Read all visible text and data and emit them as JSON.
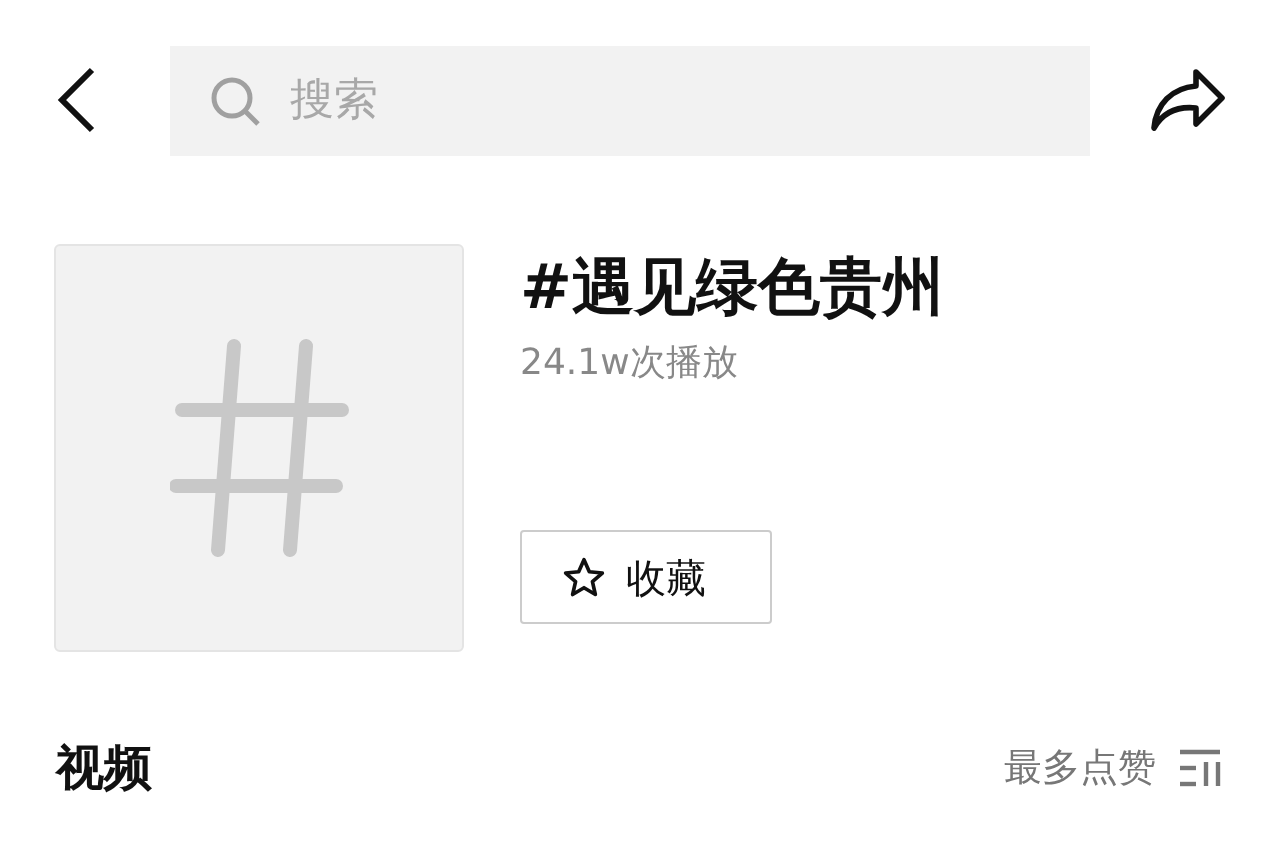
{
  "search": {
    "placeholder": "搜索"
  },
  "topic": {
    "title": "#遇见绿色贵州",
    "play_count": "24.1w次播放",
    "favorite_button": {
      "label": "收藏",
      "favorited": false
    }
  },
  "section": {
    "title": "视频",
    "sort": {
      "label": "最多点赞"
    }
  }
}
